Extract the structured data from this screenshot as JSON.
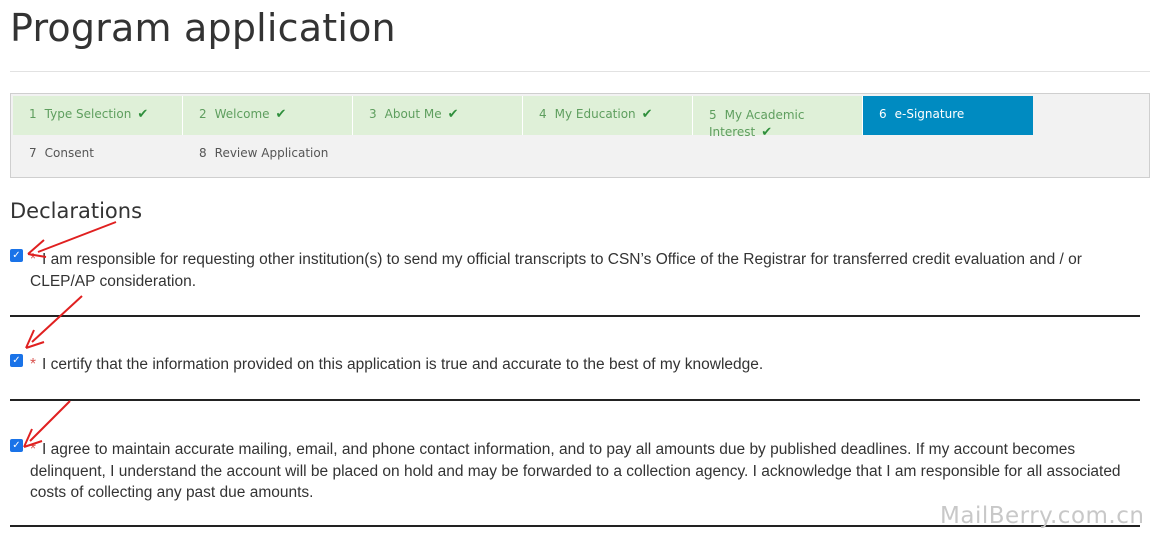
{
  "page": {
    "title": "Program application"
  },
  "stepper": {
    "steps": [
      {
        "num": "1",
        "label": "Type Selection",
        "state": "done"
      },
      {
        "num": "2",
        "label": "Welcome",
        "state": "done"
      },
      {
        "num": "3",
        "label": "About Me",
        "state": "done"
      },
      {
        "num": "4",
        "label": "My Education",
        "state": "done"
      },
      {
        "num": "5",
        "label": "My Academic",
        "label2": "Interest",
        "state": "done"
      },
      {
        "num": "6",
        "label": "e-Signature",
        "state": "active"
      },
      {
        "num": "7",
        "label": "Consent",
        "state": "pending"
      },
      {
        "num": "8",
        "label": "Review Application",
        "state": "pending"
      }
    ],
    "check_glyph": "✔"
  },
  "declarations": {
    "title": "Declarations",
    "required_marker": "*",
    "items": [
      {
        "text": "I am responsible for requesting other institution(s) to send my official transcripts to CSN’s Office of the Registrar for transferred credit evaluation and / or CLEP/AP consideration.",
        "checked": true
      },
      {
        "text": "I certify that the information provided on this application is true and accurate to the best of my knowledge.",
        "checked": true
      },
      {
        "text": "I agree to maintain accurate mailing, email, and phone contact information, and to pay all amounts due by published deadlines. If my account becomes delinquent, I understand the account will be placed on hold and may be forwarded to a collection agency. I acknowledge that I am responsible for all associated costs of collecting any past due amounts.",
        "checked": true
      }
    ]
  },
  "watermark": {
    "text": "MailBerry.com.cn"
  },
  "colors": {
    "step_done_bg": "#dff0d8",
    "step_done_text": "#5e9e5e",
    "step_active_bg": "#008bc1",
    "checkbox": "#1a73e8",
    "required": "#d9534f",
    "annotation_arrow": "#e02020"
  }
}
